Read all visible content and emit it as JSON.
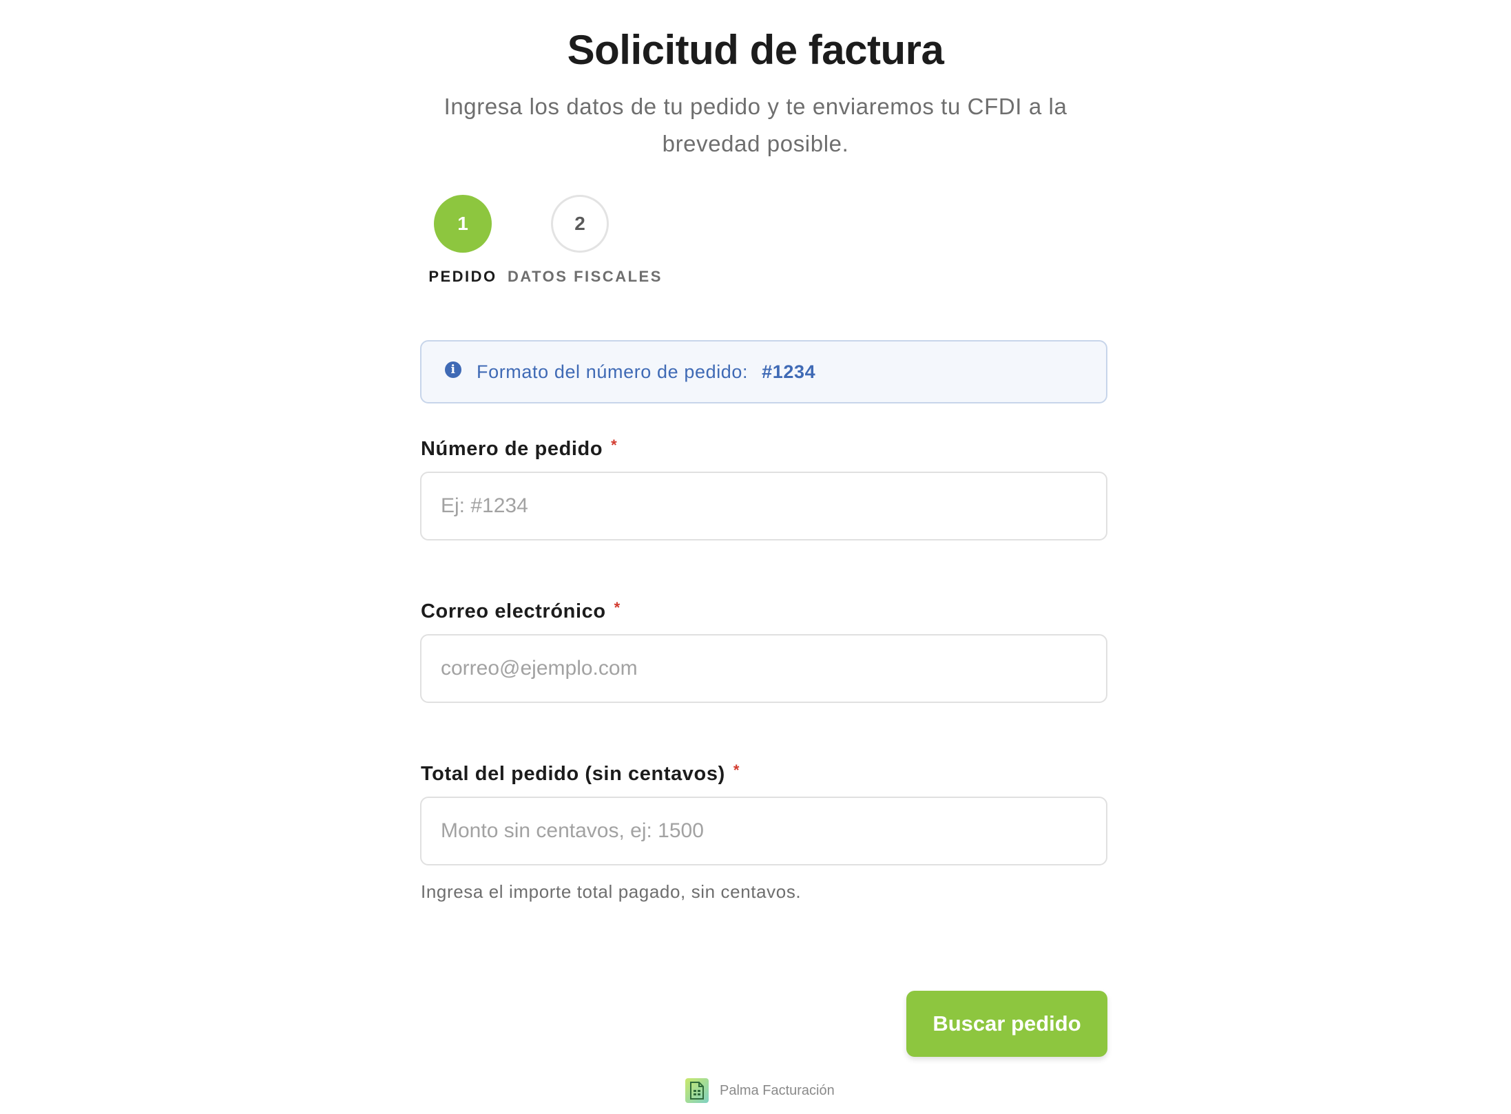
{
  "header": {
    "title": "Solicitud de factura",
    "subtitle": "Ingresa los datos de tu pedido y te enviaremos tu CFDI a la brevedad posible."
  },
  "stepper": {
    "steps": [
      {
        "number": "1",
        "label": "PEDIDO",
        "state": "active"
      },
      {
        "number": "2",
        "label": "DATOS FISCALES",
        "state": "inactive"
      }
    ]
  },
  "info": {
    "icon": "info-circle-icon",
    "text": "Formato del número de pedido:",
    "code": "#1234"
  },
  "form": {
    "order_number": {
      "label": "Número de pedido",
      "required_mark": "*",
      "placeholder": "Ej: #1234",
      "value": ""
    },
    "email": {
      "label": "Correo electrónico",
      "required_mark": "*",
      "placeholder": "correo@ejemplo.com",
      "value": ""
    },
    "total": {
      "label": "Total del pedido (sin centavos)",
      "required_mark": "*",
      "placeholder": "Monto sin centavos, ej: 1500",
      "value": "",
      "helper": "Ingresa el importe total pagado, sin centavos."
    },
    "submit_label": "Buscar pedido"
  },
  "footer": {
    "brand": "Palma Facturación",
    "icon": "spreadsheet-document-icon"
  },
  "colors": {
    "accent": "#8dc63f",
    "info_text": "#3f6ab5",
    "info_bg": "#f4f7fc",
    "required": "#d23b2f"
  }
}
